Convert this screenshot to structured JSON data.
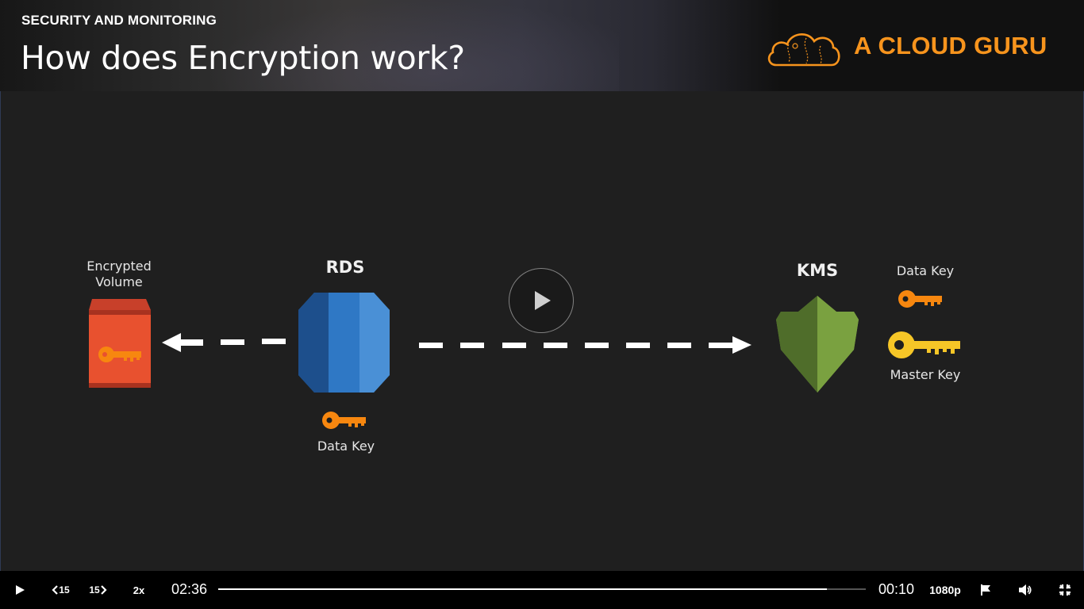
{
  "header": {
    "section_label": "SECURITY AND MONITORING",
    "title": "How does Encryption work?",
    "brand": "A CLOUD GURU",
    "brand_color": "#f7941d"
  },
  "diagram": {
    "encrypted_volume_label_line1": "Encrypted",
    "encrypted_volume_label_line2": "Volume",
    "rds_label": "RDS",
    "rds_key_label": "Data Key",
    "kms_label": "KMS",
    "kms_data_key_label": "Data Key",
    "kms_master_key_label": "Master Key",
    "icons": [
      "encrypted-volume-icon",
      "rds-database-icon",
      "kms-shield-icon",
      "data-key-icon",
      "master-key-icon"
    ],
    "colors": {
      "volume": "#e8512f",
      "rds": "#2b6fb7",
      "kms": "#6b8f3a",
      "data_key": "#f7870f",
      "master_key": "#f6c627"
    }
  },
  "player": {
    "elapsed": "02:36",
    "remaining": "00:10",
    "progress_fraction": 0.94,
    "rewind_label": "15",
    "forward_label": "15",
    "speed_label": "2x",
    "quality_label": "1080p",
    "icons": [
      "play-icon",
      "rewind-15-icon",
      "forward-15-icon",
      "flag-icon",
      "volume-icon",
      "exit-fullscreen-icon"
    ]
  }
}
